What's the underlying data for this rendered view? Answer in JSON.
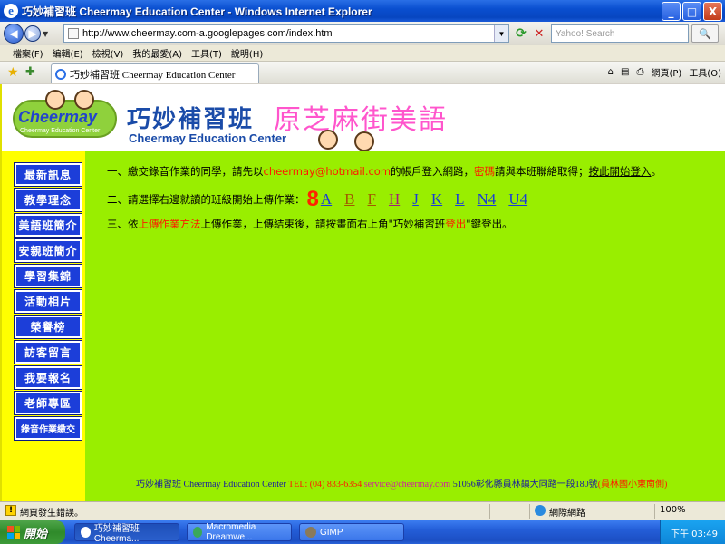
{
  "window": {
    "title": "巧妙補習班 Cheermay Education Center - Windows Internet Explorer",
    "min_label": "_",
    "max_label": "□",
    "close_label": "X"
  },
  "toolbar": {
    "url": "http://www.cheermay.com-a.googlepages.com/index.htm",
    "search_placeholder": "Yahoo! Search",
    "search_button": "🔍"
  },
  "menu": [
    "檔案(F)",
    "編輯(E)",
    "檢視(V)",
    "我的最愛(A)",
    "工具(T)",
    "說明(H)"
  ],
  "tab": {
    "label": "巧妙補習班 Cheermay Education Center"
  },
  "tools": {
    "home": "⌂",
    "feeds": "▤",
    "print": "⎙",
    "page": "網頁(P)",
    "tools": "工具(O)"
  },
  "header": {
    "logo_text": "Cheermay",
    "logo_sub": "Cheermay Education Center",
    "brand_cn": "巧妙補習班",
    "brand_en": "Cheermay Education Center",
    "brand_pink": "原芝麻街美語"
  },
  "sidebar": {
    "items": [
      "最新訊息",
      "教學理念",
      "美語班簡介",
      "安親班簡介",
      "學習集錦",
      "活動相片",
      "榮譽榜",
      "訪客留言",
      "我要報名",
      "老師專區",
      "錄音作業繳交"
    ]
  },
  "content": {
    "line1": {
      "a": "一、繳交錄音作業的同學，請先以 ",
      "email": "cheermay@hotmail.com",
      "b": " 的帳戶登入網路，",
      "pw": "密碼",
      "c": "請與本班聯絡取得；",
      "link": "按此開始登入",
      "d": "。"
    },
    "line2": {
      "a": "二、請選擇右邊就讀的班級開始上傳作業：",
      "num": "8",
      "classes": [
        "A",
        "B",
        "F",
        "H",
        "J",
        "K",
        "L",
        "N4",
        "U4"
      ]
    },
    "line3": {
      "a": "三、依",
      "method": "上傳作業方法",
      "b": "上傳作業，上傳結束後，請按畫面右上角\"巧妙補習班",
      "logout": "登出",
      "c": "\"鍵登出。"
    }
  },
  "footer": {
    "name": "巧妙補習班 Cheermay Education Center ",
    "tel": "TEL: (04) 833-6354 ",
    "email": "service@cheermay.com",
    "addr": " 51056彰化縣員林鎮大同路一段180號",
    "loc": "(員林國小東南側)"
  },
  "status": {
    "message": "網頁發生錯誤。",
    "zone": "網際網路",
    "zoom": "100%"
  },
  "taskbar": {
    "start": "開始",
    "tasks": [
      "巧妙補習班 Cheerma...",
      "Macromedia Dreamwe...",
      "GIMP"
    ],
    "clock": "下午 03:49"
  }
}
